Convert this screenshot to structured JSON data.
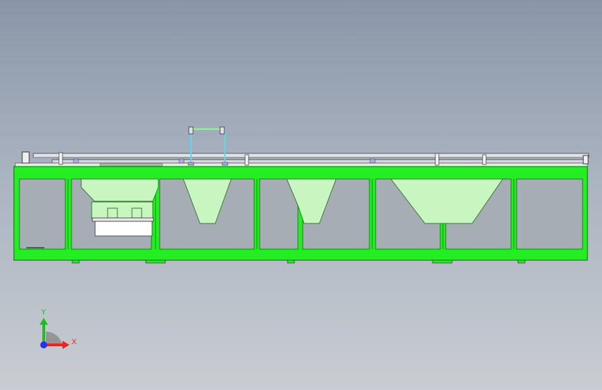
{
  "model": {
    "frame_color": "#22ee22",
    "frame_edge_color": "#0a6a0a",
    "hopper_color": "#c8f5c0",
    "hopper_edge_color": "#2e7d2e",
    "support_color": "#55ddee",
    "support_bar_color": "#88ff88",
    "rail_color": "#e0e2e6",
    "rail_edge_color": "#555a60",
    "cavity_color": "#a7adb5"
  },
  "triad": {
    "x_label": "X",
    "y_label": "Y",
    "x_color": "#ee2222",
    "y_color": "#22bb22",
    "z_color": "#2233ee",
    "x_icon": "x-axis-arrow-icon",
    "y_icon": "y-axis-arrow-icon",
    "z_icon": "z-axis-origin-icon"
  }
}
